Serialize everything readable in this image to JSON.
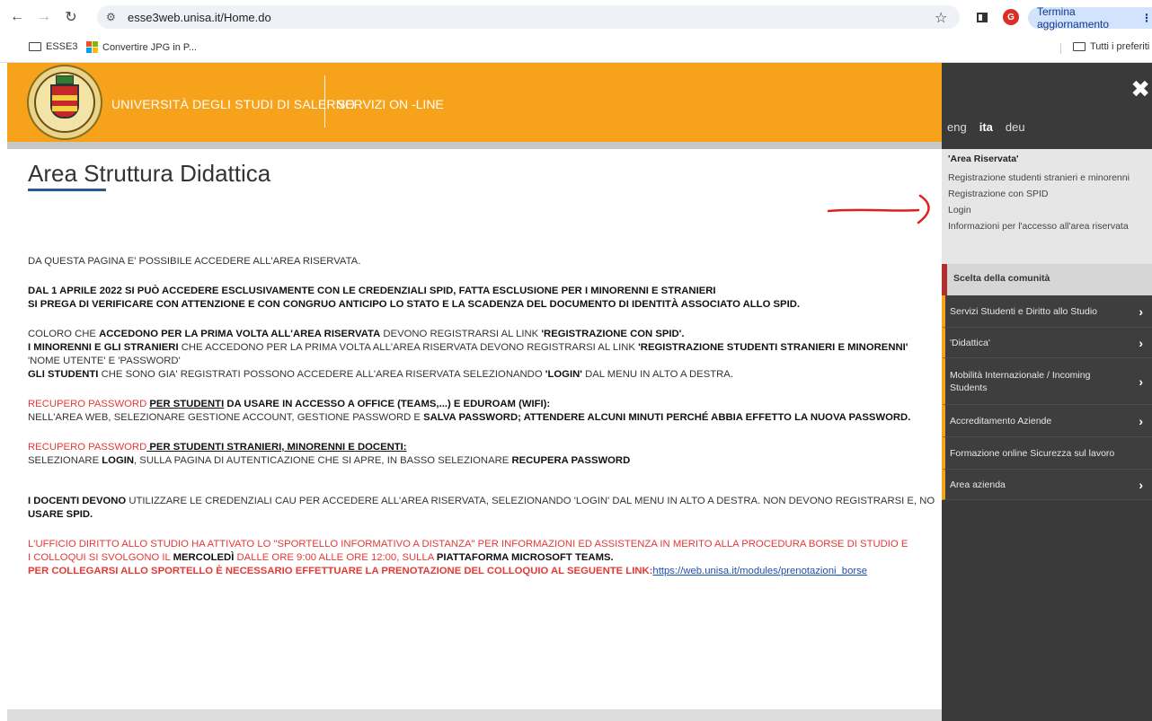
{
  "browser": {
    "url": "esse3web.unisa.it/Home.do",
    "avatar_letter": "G",
    "update_label": "Termina aggiornamento",
    "menu_glyph": "⋮",
    "bookmarks": [
      "ESSE3",
      "Convertire JPG in P...",
      "Tutti i preferiti"
    ]
  },
  "header": {
    "university": "UNIVERSITÀ DEGLI STUDI DI SALERNO",
    "servizi": "SERVIZI ON -LINE",
    "accent": "#f7a21b"
  },
  "page": {
    "title": "Area Struttura Didattica",
    "p1": "DA QUESTA PAGINA E' POSSIBILE ACCEDERE ALL'AREA RISERVATA.",
    "p2a": "DAL 1 APRILE 2022 SI PUÒ ACCEDERE ESCLUSIVAMENTE CON LE CREDENZIALI SPID, FATTA ESCLUSIONE PER I MINORENNI E STRANIERI",
    "p2b": "SI PREGA DI VERIFICARE CON ATTENZIONE E CON CONGRUO ANTICIPO LO STATO E LA SCADENZA DEL DOCUMENTO DI IDENTITÀ ASSOCIATO ALLO SPID.",
    "p3_1a": "COLORO CHE ",
    "p3_1b": "ACCEDONO PER LA PRIMA VOLTA ALL'AREA RISERVATA",
    "p3_1c": " DEVONO REGISTRARSI AL LINK ",
    "p3_1d": "'REGISTRAZIONE CON SPID'.",
    "p3_2a": "I MINORENNI E GLI STRANIERI",
    "p3_2b": " CHE ACCEDONO PER LA PRIMA VOLTA ALL'AREA RISERVATA DEVONO REGISTRARSI AL LINK ",
    "p3_2c": "'REGISTRAZIONE STUDENTI STRANIERI E MINORENNI'",
    "p3_3": "'NOME UTENTE' E 'PASSWORD'",
    "p3_4a": "GLI STUDENTI",
    "p3_4b": " CHE SONO GIA' REGISTRATI POSSONO ACCEDERE ALL'AREA RISERVATA SELEZIONANDO ",
    "p3_4c": "'LOGIN'",
    "p3_4d": " DAL MENU IN ALTO A DESTRA.",
    "p4_1a": "RECUPERO PASSWORD ",
    "p4_1b": "PER STUDENTI",
    "p4_1c": " DA USARE IN ACCESSO A OFFICE (TEAMS,...) E EDUROAM (WIFI):",
    "p4_2a": "NELL'AREA WEB, SELEZIONARE GESTIONE ACCOUNT, GESTIONE PASSWORD E ",
    "p4_2b": "SALVA PASSWORD; ATTENDERE ALCUNI MINUTI PERCHÉ ABBIA EFFETTO LA NUOVA PASSWORD.",
    "p5_1a": "RECUPERO PASSWORD",
    "p5_1b": " PER STUDENTI STRANIERI, MINORENNI E DOCENTI:",
    "p5_2a": "SELEZIONARE ",
    "p5_2b": "LOGIN",
    "p5_2c": ", SULLA PAGINA DI AUTENTICAZIONE CHE SI APRE, IN BASSO SELEZIONARE ",
    "p5_2d": "RECUPERA PASSWORD",
    "p6_1a": "I DOCENTI DEVONO",
    "p6_1b": " UTILIZZARE LE CREDENZIALI CAU PER ACCEDERE ALL'AREA RISERVATA, SELEZIONANDO 'LOGIN' DAL MENU IN ALTO A DESTRA. NON DEVONO REGISTRARSI E, NO",
    "p6_2": "USARE SPID.",
    "p7_1": "L'UFFICIO DIRITTO ALLO STUDIO HA ATTIVATO LO \"SPORTELLO INFORMATIVO A DISTANZA\" PER INFORMAZIONI ED ASSISTENZA IN MERITO ALLA PROCEDURA BORSE DI STUDIO E",
    "p7_2a": "I COLLOQUI SI SVOLGONO IL ",
    "p7_2b": "MERCOLEDÌ",
    "p7_2c": " DALLE ORE 9:00 ALLE ORE 12:00, SULLA ",
    "p7_2d": "PIATTAFORMA MICROSOFT TEAMS.",
    "p7_3": "PER COLLEGARSI ALLO SPORTELLO È NECESSARIO EFFETTUARE LA PRENOTAZIONE DEL COLLOQUIO AL SEGUENTE LINK:",
    "p7_link": "https://web.unisa.it/modules/prenotazioni_borse"
  },
  "sidemenu": {
    "close": "✖",
    "languages": [
      "eng",
      "ita",
      "deu"
    ],
    "reserved_header": "'Area Riservata'",
    "reserved_items": [
      "Registrazione studenti stranieri e minorenni",
      "Registrazione con SPID",
      "Login",
      "Informazioni per l'accesso all'area riservata"
    ],
    "community_header": "Scelta della comunità",
    "items": [
      "Servizi Studenti e Diritto allo Studio",
      "'Didattica'",
      "Mobilità Internazionale / Incoming Students",
      "Accreditamento Aziende",
      "Formazione online Sicurezza sul lavoro",
      "Area azienda"
    ]
  }
}
